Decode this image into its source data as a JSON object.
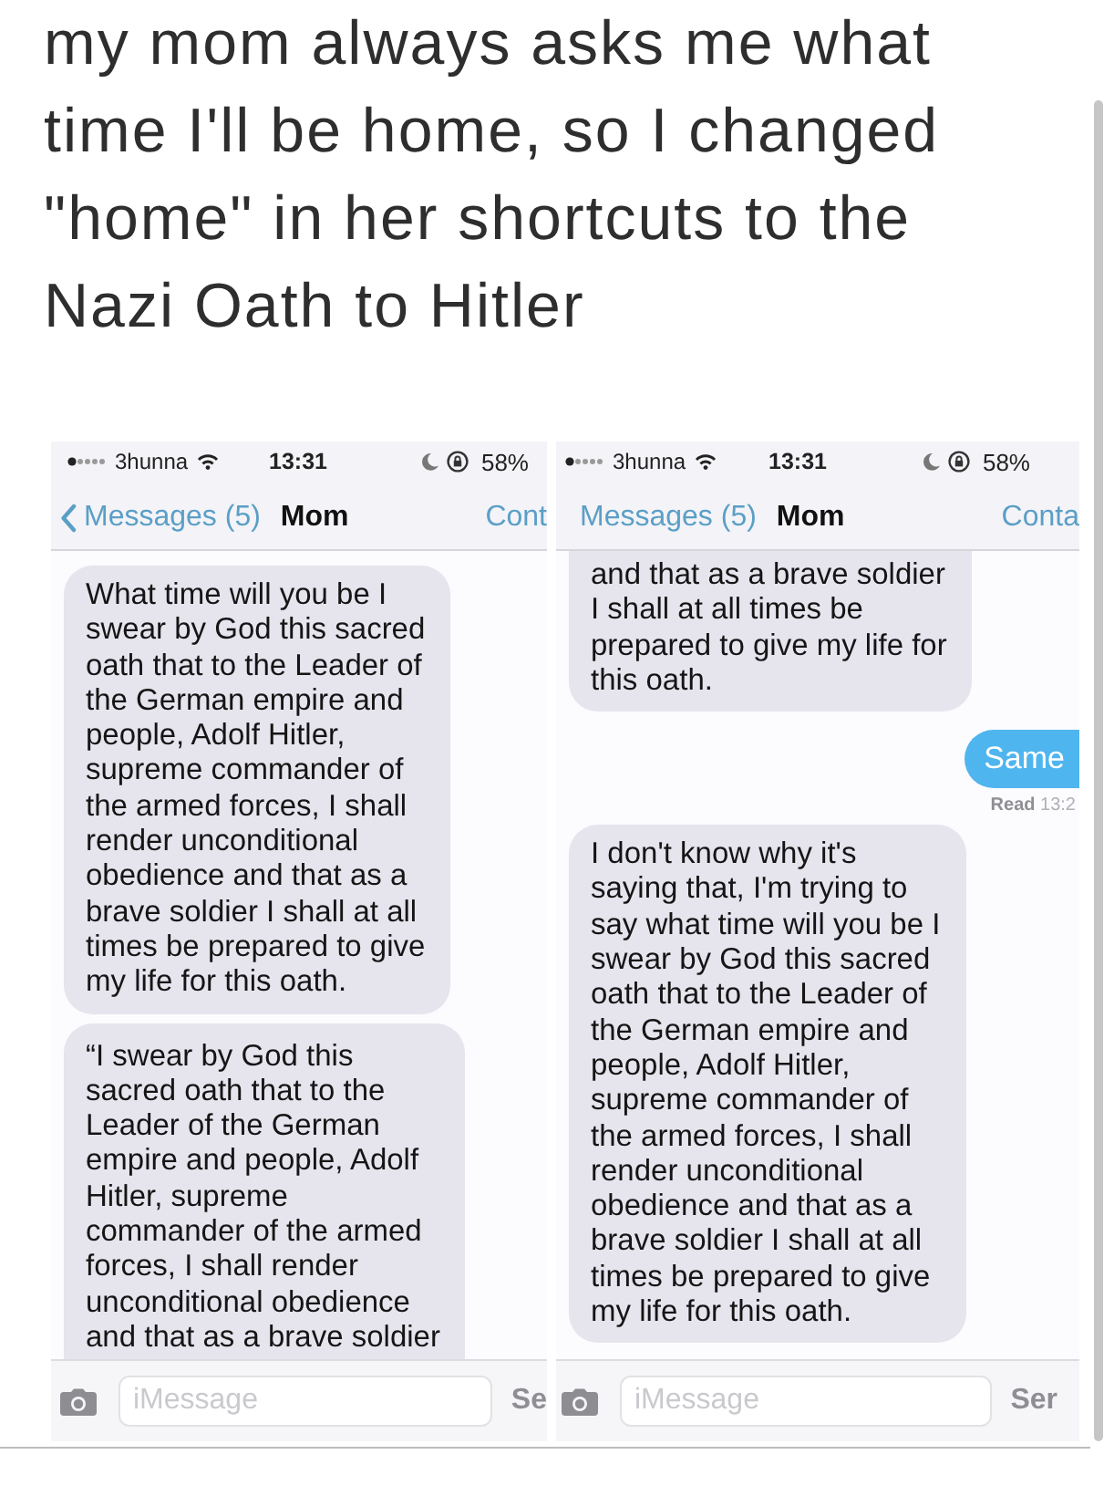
{
  "caption": "my mom always asks me what\ntime I'll be home, so I changed\n\"home\" in her shortcuts to the\nNazi Oath to Hitler",
  "phones": [
    {
      "status_bar": {
        "carrier": "3hunna",
        "time": "13:31",
        "battery": "58%"
      },
      "nav_bar": {
        "back_chevron": true,
        "back_label": "Messages (5)",
        "title": "Mom",
        "action": "Cont"
      },
      "messages": [
        {
          "kind": "received",
          "cut_top": false,
          "cut_bottom": false,
          "cut_right": false,
          "text": "What time will you be I\nswear by God this sacred\noath that to the Leader of\nthe German empire and\npeople, Adolf Hitler,\nsupreme commander of\nthe armed forces, I shall\nrender unconditional\nobedience and that as a\nbrave soldier I shall at all\ntimes be prepared to give\nmy life for this oath."
        },
        {
          "kind": "received",
          "cut_top": false,
          "cut_bottom": true,
          "cut_right": false,
          "text": "“I swear by God this\nsacred oath that to the\nLeader of the German\nempire and people, Adolf\nHitler, supreme\ncommander of the armed\nforces, I shall render\nunconditional obedience\nand that as a brave soldier"
        }
      ],
      "input_bar": {
        "placeholder": "iMessage",
        "send_label": "Se"
      }
    },
    {
      "status_bar": {
        "carrier": "3hunna",
        "time": "13:31",
        "battery": "58%"
      },
      "nav_bar": {
        "back_chevron": false,
        "back_label": "Messages (5)",
        "title": "Mom",
        "action": "Conta"
      },
      "messages": [
        {
          "kind": "received",
          "cut_top": true,
          "cut_bottom": false,
          "cut_right": false,
          "text": "and that as a brave soldier\nI shall at all times be\nprepared to give my life for\nthis oath."
        },
        {
          "kind": "sent",
          "cut_top": false,
          "cut_bottom": false,
          "cut_right": true,
          "text": "Same",
          "receipt": "**Read** 13:2"
        },
        {
          "kind": "received",
          "cut_top": false,
          "cut_bottom": false,
          "cut_right": false,
          "text": "I don't know why it's\nsaying that, I'm trying to\nsay what time will you be I\nswear by God this sacred\noath that to the Leader of\nthe German empire and\npeople, Adolf Hitler,\nsupreme commander of\nthe armed forces, I shall\nrender unconditional\nobedience and that as a\nbrave soldier I shall at all\ntimes be prepared to give\nmy life for this oath."
        }
      ],
      "input_bar": {
        "placeholder": "iMessage",
        "send_label": "Ser"
      }
    }
  ]
}
